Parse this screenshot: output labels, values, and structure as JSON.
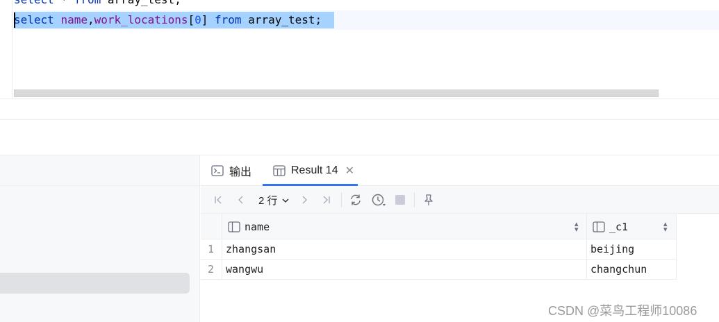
{
  "editor": {
    "line1": {
      "kw1": "select",
      "op": " * ",
      "kw2": "from",
      "rest": " array_test;"
    },
    "line2": {
      "kw1": "select",
      "sp": " ",
      "col1": "name",
      "comma": ",",
      "col2": "work_locations",
      "lb": "[",
      "idx": "0",
      "rb": "]",
      "sp2": " ",
      "kw2": "from",
      "table": " array_test;"
    }
  },
  "tabs": [
    {
      "label": "输出",
      "icon": "console-icon"
    },
    {
      "label": "Result 14",
      "icon": "table-icon",
      "active": true
    }
  ],
  "toolbar": {
    "rows_label": "2 行",
    "icons": [
      "first-page-icon",
      "prev-page-icon",
      "next-page-icon",
      "last-page-icon",
      "refresh-icon",
      "history-icon",
      "stop-icon",
      "pin-icon"
    ]
  },
  "grid": {
    "columns": [
      "name",
      "_c1"
    ],
    "rows": [
      {
        "num": "1",
        "cells": [
          "zhangsan",
          "beijing"
        ]
      },
      {
        "num": "2",
        "cells": [
          "wangwu",
          "changchun"
        ]
      }
    ]
  },
  "watermark": "CSDN @菜鸟工程师10086",
  "colors": {
    "accent": "#3574f0",
    "selection": "#a6d2ff",
    "keyword": "#0033b3",
    "identifier": "#871094"
  }
}
